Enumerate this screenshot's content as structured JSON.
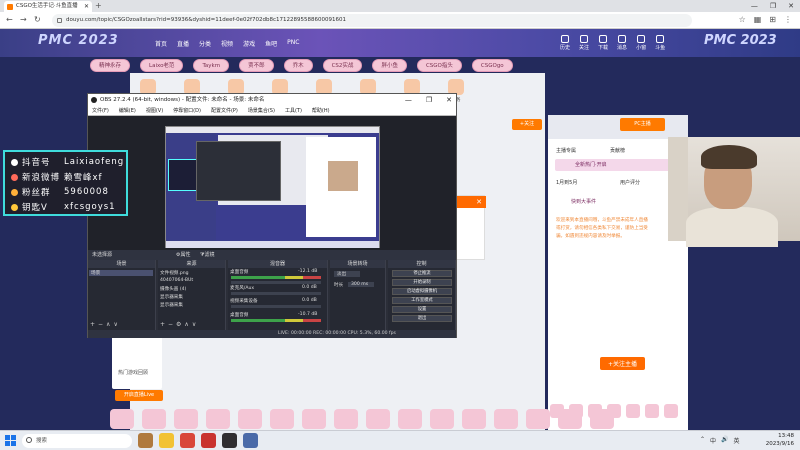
{
  "browser": {
    "tab_title": "CSGO生活手记·斗鱼直播",
    "new_tab": "+",
    "window_controls": [
      "—",
      "❐",
      "✕"
    ],
    "url": "douyu.com/topic/CSGOzoallstars?rid=93936&dyshid=11deef-0e02f702db8c17122895588600091601",
    "nav": [
      "←",
      "→",
      "↻"
    ],
    "tools": [
      "☆",
      "▦",
      "⊞",
      "⋮"
    ]
  },
  "site": {
    "event_left": "PMC 2023",
    "event_right": "PMC 2023",
    "nav": [
      "首页",
      "直播",
      "分类",
      "视频",
      "游戏",
      "鱼吧",
      "PNC"
    ],
    "header_icons": [
      "历史",
      "关注",
      "下载",
      "消息",
      "小窗",
      "斗鱼"
    ],
    "pills": [
      "精神永存",
      "Laixo老范",
      "Taykm",
      "贾不郎",
      "乔木",
      "CS2实战",
      "胖小鱼",
      "CSGO指头",
      "CSGOgo"
    ],
    "gifts": [
      "礼物",
      "粉丝",
      "鱼丸",
      "贵族",
      "排行",
      "奖励",
      "活动",
      "任务"
    ],
    "follow_btn": "+关注",
    "promo_text": "热门游戏回顾",
    "promo_btn": "开启直播Live",
    "right_top_btn": "PC主播",
    "rb_tab1": "主播专属",
    "rb_tab2": "贡献榜",
    "rb_badge": "全新热门·开启",
    "rb_tab3": "1月到5月",
    "rb_tab4": "用户评分",
    "rb_badge2": "快到大事件",
    "rb_chat": [
      "欢迎来到本直播间哦，斗鱼严禁未成年人直播",
      "或打赏，请勿相信各类私下交易，谨防上当受",
      "骗，如遇到违规内容请及时举报。"
    ],
    "rb_red": "+关注主播"
  },
  "obs": {
    "title": "OBS 27.2.4 (64-bit, windows) - 配置文件: 未命名 - 场景: 未命名",
    "menu": [
      "文件(F)",
      "编辑(E)",
      "视图(V)",
      "停靠窗口(D)",
      "配置文件(P)",
      "场景集合(S)",
      "工具(T)",
      "帮助(H)"
    ],
    "toolbar_label": "未选择源",
    "props_label": "⚙属性",
    "filters_label": "⧩滤镜",
    "docks": {
      "scenes": "场景",
      "sources": "来源",
      "mixer": "混音器",
      "transitions": "场景转场",
      "controls": "控制"
    },
    "scene_items": [
      "场景"
    ],
    "source_items": [
      "文件视频.png",
      "40407064-BUt",
      "摄像头画 (4)",
      "显示器采集",
      "显示器采集"
    ],
    "mixer_items": [
      {
        "name": "桌面音频",
        "db": "-12.1 dB"
      },
      {
        "name": "麦克风/Aux",
        "db": "0.0 dB"
      },
      {
        "name": "视频采集设备",
        "db": "0.0 dB"
      },
      {
        "name": "桌面音频",
        "db": "-10.7 dB"
      }
    ],
    "transition_type": "淡出",
    "duration_label": "时长",
    "duration_value": "300 ms",
    "controls": [
      "停止推流",
      "开始录制",
      "启动虚拟摄像机",
      "工作室模式",
      "设置",
      "退出"
    ],
    "status": "LIVE: 00:00:00   REC: 00:00:00   CPU: 5.3%, 60.00 fps"
  },
  "overlay": {
    "rows": [
      {
        "label": "抖音号",
        "value": "Laixiaofeng",
        "color": "#ffffff"
      },
      {
        "label": "新浪微博",
        "value": "赖雪峰xf",
        "color": "#ff6a5a"
      },
      {
        "label": "粉丝群",
        "value": "5960008",
        "color": "#ffb03a"
      },
      {
        "label": "钥匙V",
        "value": "xfcsgoys1",
        "color": "#ffc83a"
      }
    ]
  },
  "taskbar": {
    "search_placeholder": "搜索",
    "time": "13:48",
    "date": "2023/9/16",
    "tray": [
      "⌃",
      "中",
      "🔊",
      "英"
    ]
  },
  "colors": {
    "accent_orange": "#ff7a00",
    "overlay_border": "#3fdcdc"
  }
}
